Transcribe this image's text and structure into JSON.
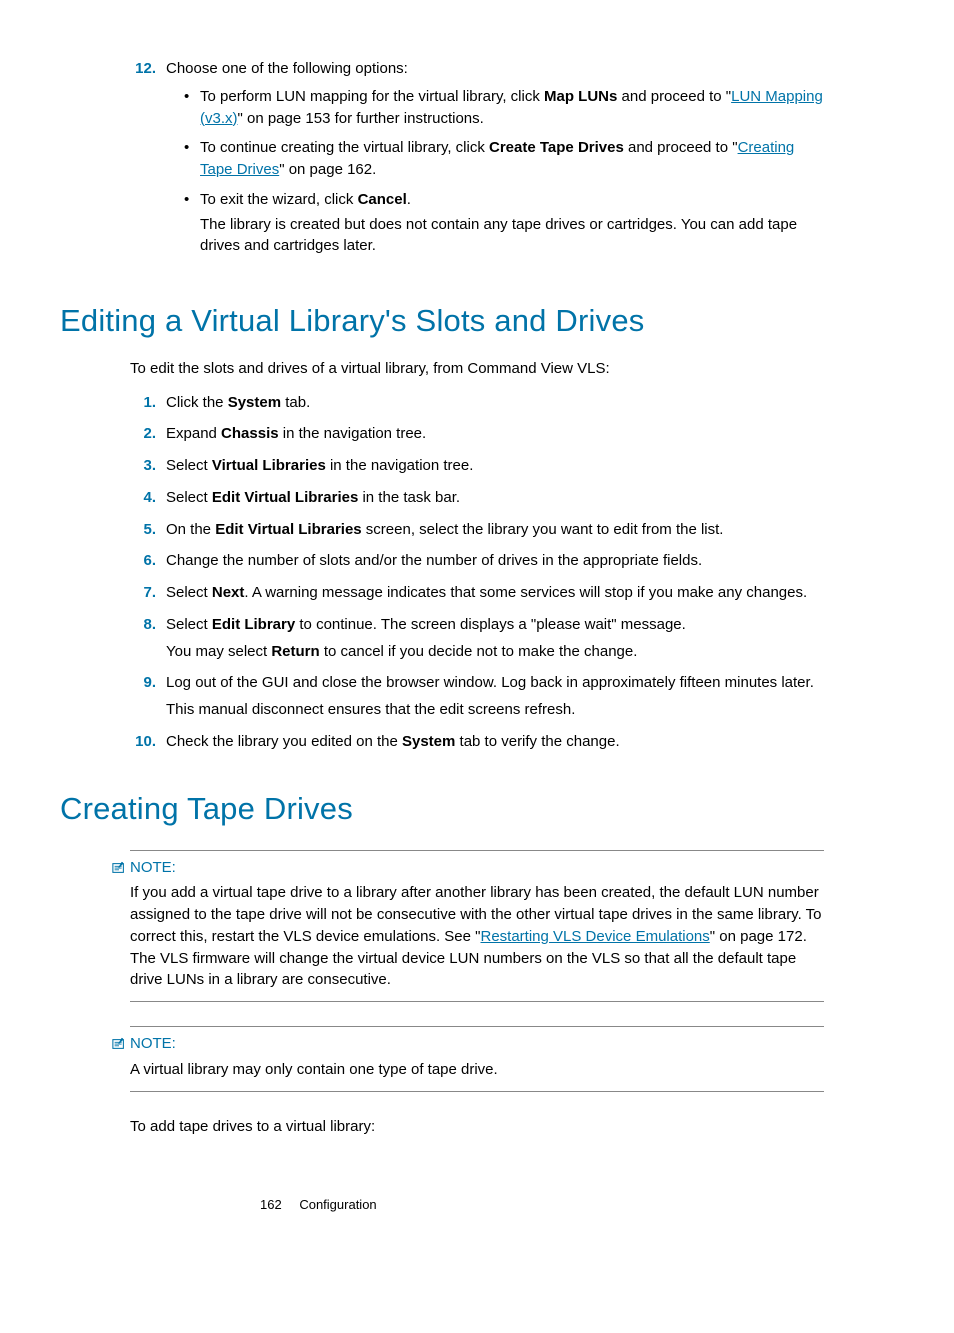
{
  "step12": {
    "num": "12.",
    "text": "Choose one of the following options:",
    "bullets": [
      {
        "pre": "To perform LUN mapping for the virtual library, click ",
        "b1": "Map LUNs",
        "mid": " and proceed to \"",
        "link": "LUN Mapping (v3.x)",
        "post": "\" on page 153 for further instructions."
      },
      {
        "pre": "To continue creating the virtual library, click ",
        "b1": "Create Tape Drives",
        "mid": " and proceed to \"",
        "link": "Creating Tape Drives",
        "post": "\" on page 162."
      },
      {
        "pre": "To exit the wizard, click ",
        "b1": "Cancel",
        "post2": ".",
        "sub": "The library is created but does not contain any tape drives or cartridges. You can add tape drives and cartridges later."
      }
    ]
  },
  "h_editing": "Editing a Virtual Library's Slots and Drives",
  "editing_intro": "To edit the slots and drives of a virtual library, from Command View VLS:",
  "edit_steps": [
    {
      "num": "1.",
      "pre": "Click the ",
      "b": "System",
      "post": " tab."
    },
    {
      "num": "2.",
      "pre": "Expand ",
      "b": "Chassis",
      "post": " in the navigation tree."
    },
    {
      "num": "3.",
      "pre": "Select ",
      "b": "Virtual Libraries",
      "post": " in the navigation tree."
    },
    {
      "num": "4.",
      "pre": "Select ",
      "b": "Edit Virtual Libraries",
      "post": " in the task bar."
    },
    {
      "num": "5.",
      "pre": "On the ",
      "b": "Edit Virtual Libraries",
      "post": " screen, select the library you want to edit from the list."
    },
    {
      "num": "6.",
      "plain": "Change the number of slots and/or the number of drives in the appropriate fields."
    },
    {
      "num": "7.",
      "pre": "Select ",
      "b": "Next",
      "post": ". A warning message indicates that some services will stop if you make any changes."
    },
    {
      "num": "8.",
      "pre": "Select ",
      "b": "Edit Library",
      "post": " to continue. The screen displays a \"please wait\" message.",
      "sub_pre": "You may select ",
      "sub_b": "Return",
      "sub_post": " to cancel if you decide not to make the change."
    },
    {
      "num": "9.",
      "plain": "Log out of the GUI and close the browser window. Log back in approximately fifteen minutes later.",
      "sub_plain": "This manual disconnect ensures that the edit screens refresh."
    },
    {
      "num": "10.",
      "pre": "Check the library you edited on the ",
      "b": "System",
      "post": " tab to verify the change."
    }
  ],
  "h_creating": "Creating Tape Drives",
  "note_label": "NOTE:",
  "note1": {
    "pre": "If you add a virtual tape drive to a library after another library has been created, the default LUN number assigned to the tape drive will not be consecutive with the other virtual tape drives in the same library. To correct this, restart the VLS device emulations. See \"",
    "link": "Restarting VLS Device Emulations",
    "post": "\" on page 172. The VLS firmware will change the virtual device LUN numbers on the VLS so that all the default tape drive LUNs in a library are consecutive."
  },
  "note2": "A virtual library may only contain one type of tape drive.",
  "creating_intro": "To add tape drives to a virtual library:",
  "footer": {
    "page": "162",
    "section": "Configuration"
  }
}
